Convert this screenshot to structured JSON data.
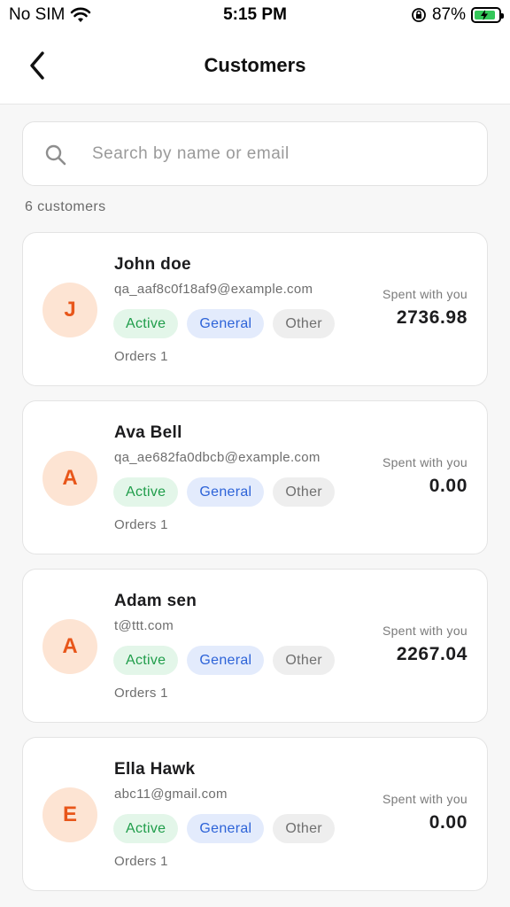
{
  "status_bar": {
    "carrier": "No SIM",
    "time": "5:15 PM",
    "battery": "87%",
    "battery_level": 0.87,
    "icons": [
      "wifi-icon",
      "rotation-lock-icon",
      "battery-charging-icon"
    ]
  },
  "header": {
    "title": "Customers",
    "back_icon": "chevron-left-icon"
  },
  "search": {
    "placeholder": "Search by name or email",
    "value": "",
    "icon": "search-icon"
  },
  "count_label": "6 customers",
  "colors": {
    "avatar_bg": "#fde4d3",
    "avatar_text": "#e8561a",
    "active_bg": "#e3f6e9",
    "active_text": "#1f9d4a",
    "general_bg": "#e3ebfc",
    "general_text": "#2d63d8",
    "other_bg": "#eeeeee",
    "other_text": "#6f6f6f"
  },
  "customers": [
    {
      "initial": "J",
      "name": "John doe",
      "email": "qa_aaf8c0f18af9@example.com",
      "tags": [
        "Active",
        "General",
        "Other"
      ],
      "orders": "Orders 1",
      "spent_label": "Spent with you",
      "spent": "2736.98"
    },
    {
      "initial": "A",
      "name": "Ava Bell",
      "email": "qa_ae682fa0dbcb@example.com",
      "tags": [
        "Active",
        "General",
        "Other"
      ],
      "orders": "Orders 1",
      "spent_label": "Spent with you",
      "spent": "0.00"
    },
    {
      "initial": "A",
      "name": "Adam sen",
      "email": "t@ttt.com",
      "tags": [
        "Active",
        "General",
        "Other"
      ],
      "orders": "Orders 1",
      "spent_label": "Spent with you",
      "spent": "2267.04"
    },
    {
      "initial": "E",
      "name": "Ella Hawk",
      "email": "abc11@gmail.com",
      "tags": [
        "Active",
        "General",
        "Other"
      ],
      "orders": "Orders 1",
      "spent_label": "Spent with you",
      "spent": "0.00"
    }
  ]
}
